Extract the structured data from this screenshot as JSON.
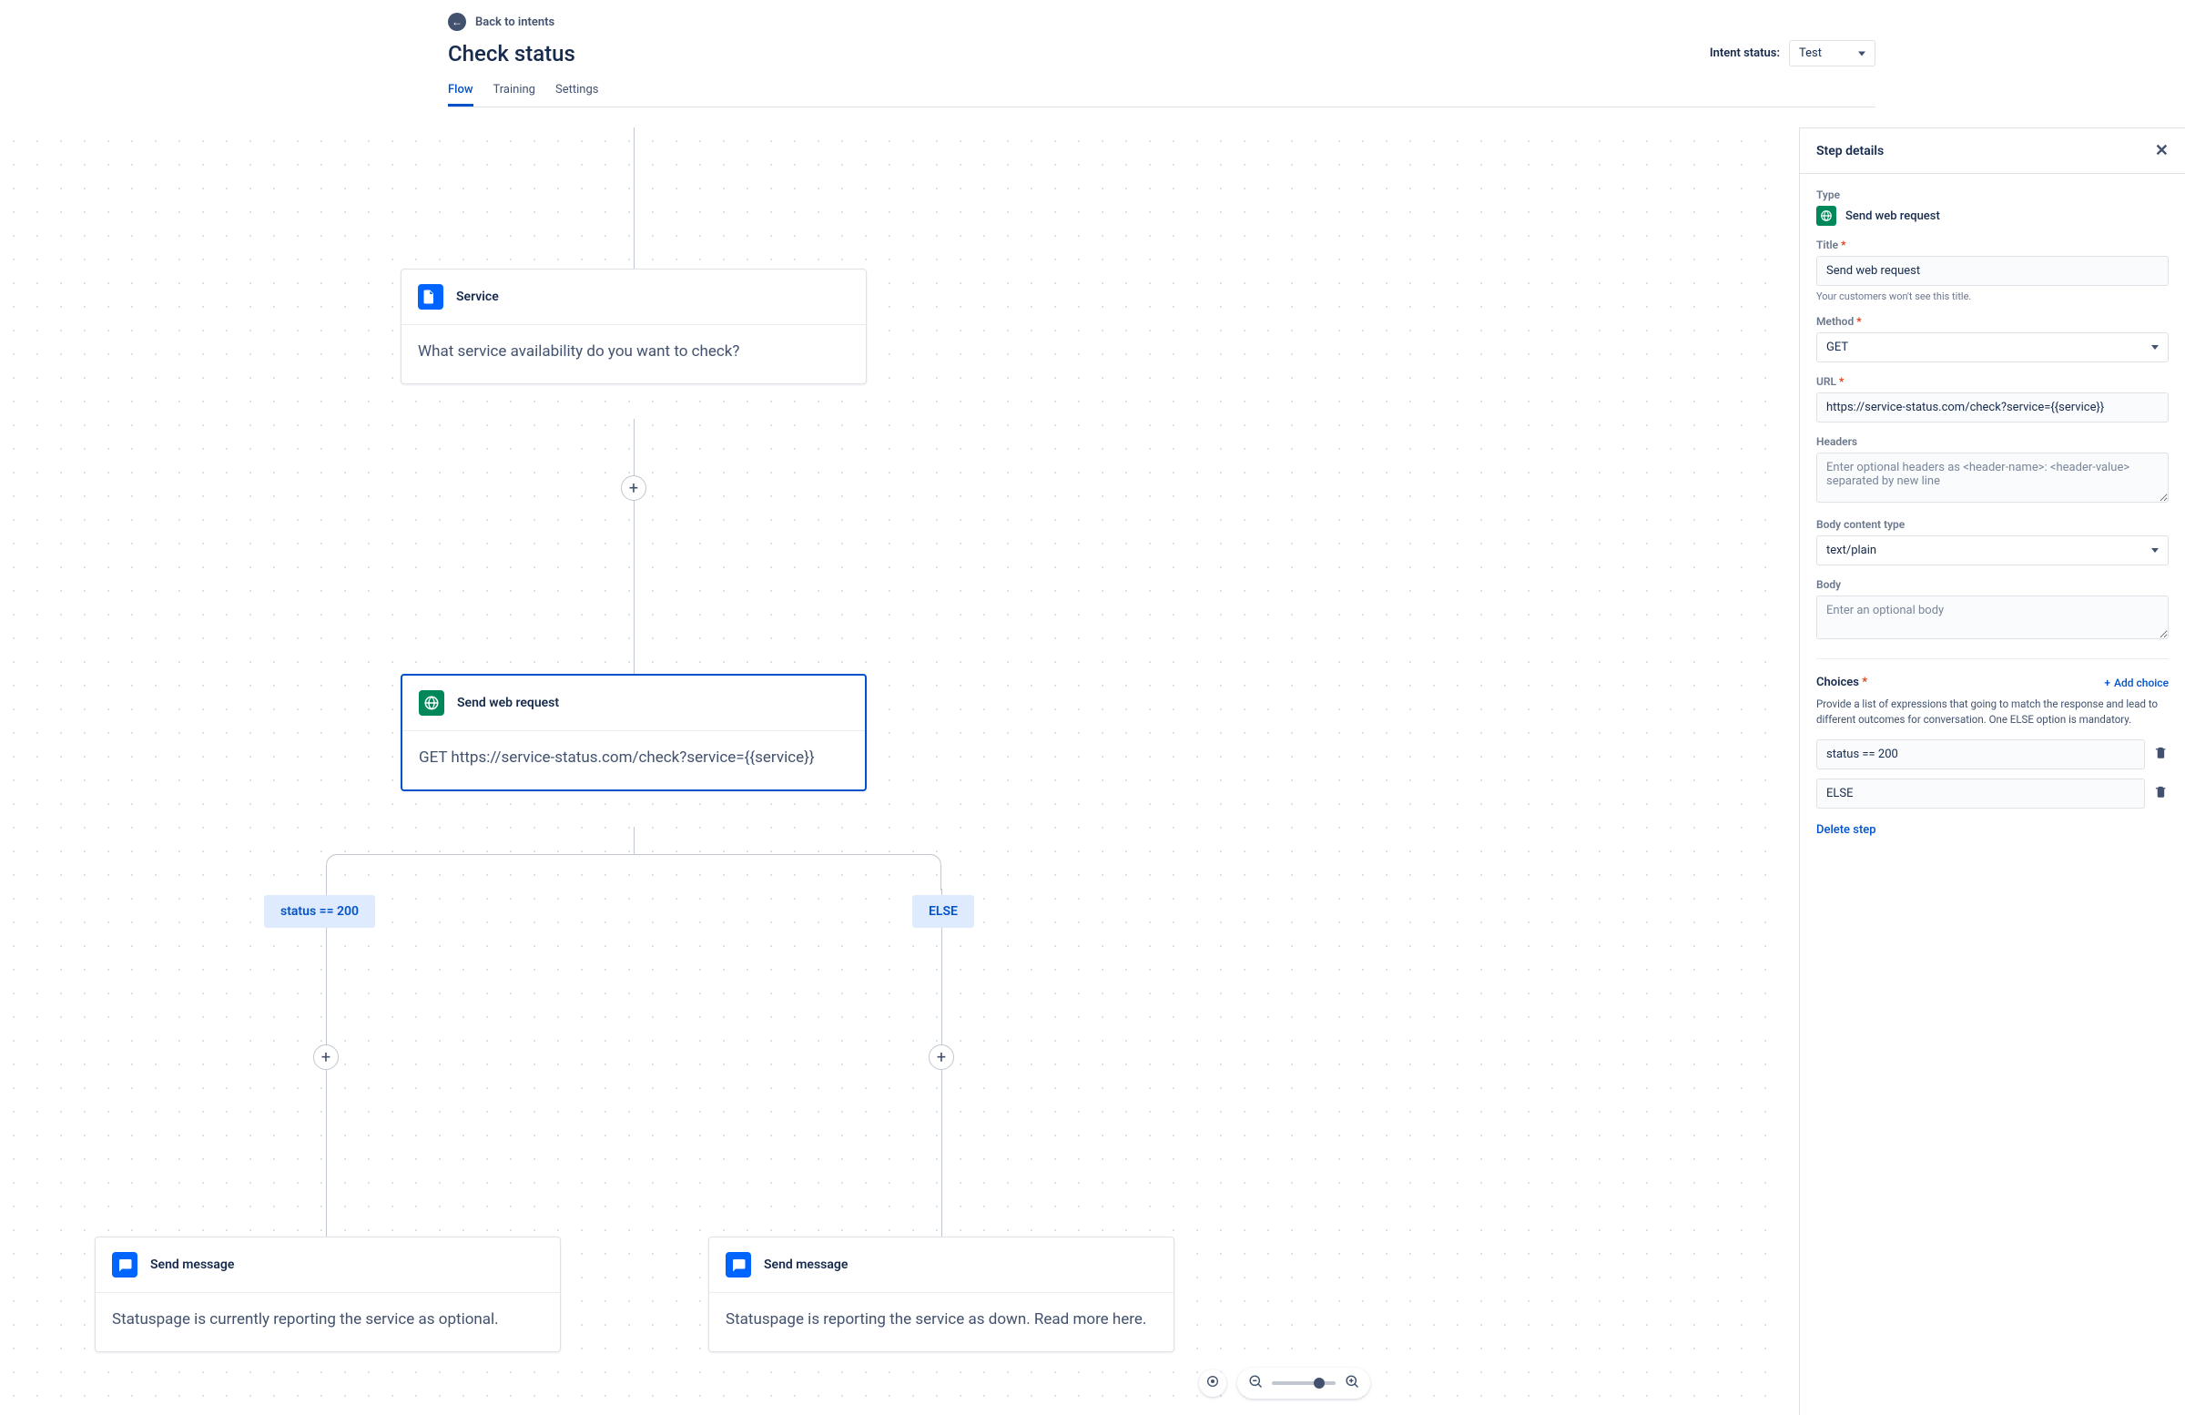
{
  "header": {
    "back_label": "Back to intents",
    "page_title": "Check status",
    "intent_status_label": "Intent status:",
    "intent_status_value": "Test",
    "tabs": {
      "flow": "Flow",
      "training": "Training",
      "settings": "Settings"
    }
  },
  "nodes": {
    "service": {
      "title": "Service",
      "body": "What service availability do you want to check?"
    },
    "webreq": {
      "title": "Send web request",
      "body": "GET https://service-status.com/check?service={{service}}"
    },
    "msg_ok": {
      "title": "Send message",
      "body": "Statuspage is currently reporting the service as optional."
    },
    "msg_down": {
      "title": "Send message",
      "body": "Statuspage is reporting the service as down. Read more here."
    }
  },
  "branches": {
    "ok": "status == 200",
    "else": "ELSE"
  },
  "panel": {
    "title": "Step details",
    "type_label": "Type",
    "type_value": "Send web request",
    "title_label": "Title",
    "title_value": "Send web request",
    "title_help": "Your customers won't see this title.",
    "method_label": "Method",
    "method_value": "GET",
    "url_label": "URL",
    "url_value": "https://service-status.com/check?service={{service}}",
    "headers_label": "Headers",
    "headers_placeholder": "Enter optional headers as <header-name>: <header-value> separated by new line",
    "bodytype_label": "Body content type",
    "bodytype_value": "text/plain",
    "body_label": "Body",
    "body_placeholder": "Enter an optional body",
    "choices_label": "Choices",
    "add_choice": "Add choice",
    "choices_desc": "Provide a list of expressions that going to match the response and lead to different outcomes for conversation. One ELSE option is mandatory.",
    "choice1": "status == 200",
    "choice2": "ELSE",
    "delete_step": "Delete step"
  }
}
